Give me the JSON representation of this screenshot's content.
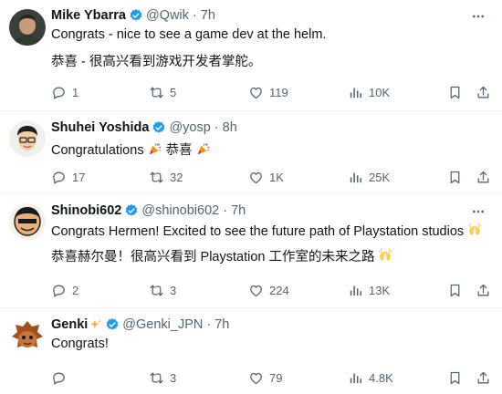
{
  "tweets": [
    {
      "name": "Mike Ybarra",
      "handle": "@Qwik",
      "time": "7h",
      "lines": [
        "Congrats - nice to see a game dev at the helm.",
        "恭喜 - 很高兴看到游戏开发者掌舵。"
      ],
      "replies": "1",
      "reposts": "5",
      "likes": "119",
      "views": "10K"
    },
    {
      "name": "Shuhei Yoshida",
      "handle": "@yosp",
      "time": "8h",
      "lines": [
        "Congratulations",
        "恭喜"
      ],
      "replies": "17",
      "reposts": "32",
      "likes": "1K",
      "views": "25K"
    },
    {
      "name": "Shinobi602",
      "handle": "@shinobi602",
      "time": "7h",
      "lines": [
        "Congrats Hermen! Excited to see the future path of Playstation studios",
        "恭喜赫尔曼！很高兴看到 Playstation 工作室的未来之路"
      ],
      "replies": "2",
      "reposts": "3",
      "likes": "224",
      "views": "13K"
    },
    {
      "name": "Genki",
      "handle": "@Genki_JPN",
      "time": "7h",
      "lines": [
        "Congrats!"
      ],
      "replies": "",
      "reposts": "3",
      "likes": "79",
      "views": "4.8K"
    }
  ],
  "separator": "·",
  "icons": [
    "more-icon",
    "verified-badge-icon",
    "reply-icon",
    "repost-icon",
    "like-icon",
    "views-icon",
    "bookmark-icon",
    "share-icon",
    "party-popper-emoji",
    "raising-hands-emoji",
    "sparkles-emoji"
  ],
  "colors": {
    "accent": "#1d9bf0",
    "muted": "#536471",
    "text": "#0f1419",
    "border": "#eff3f4"
  }
}
